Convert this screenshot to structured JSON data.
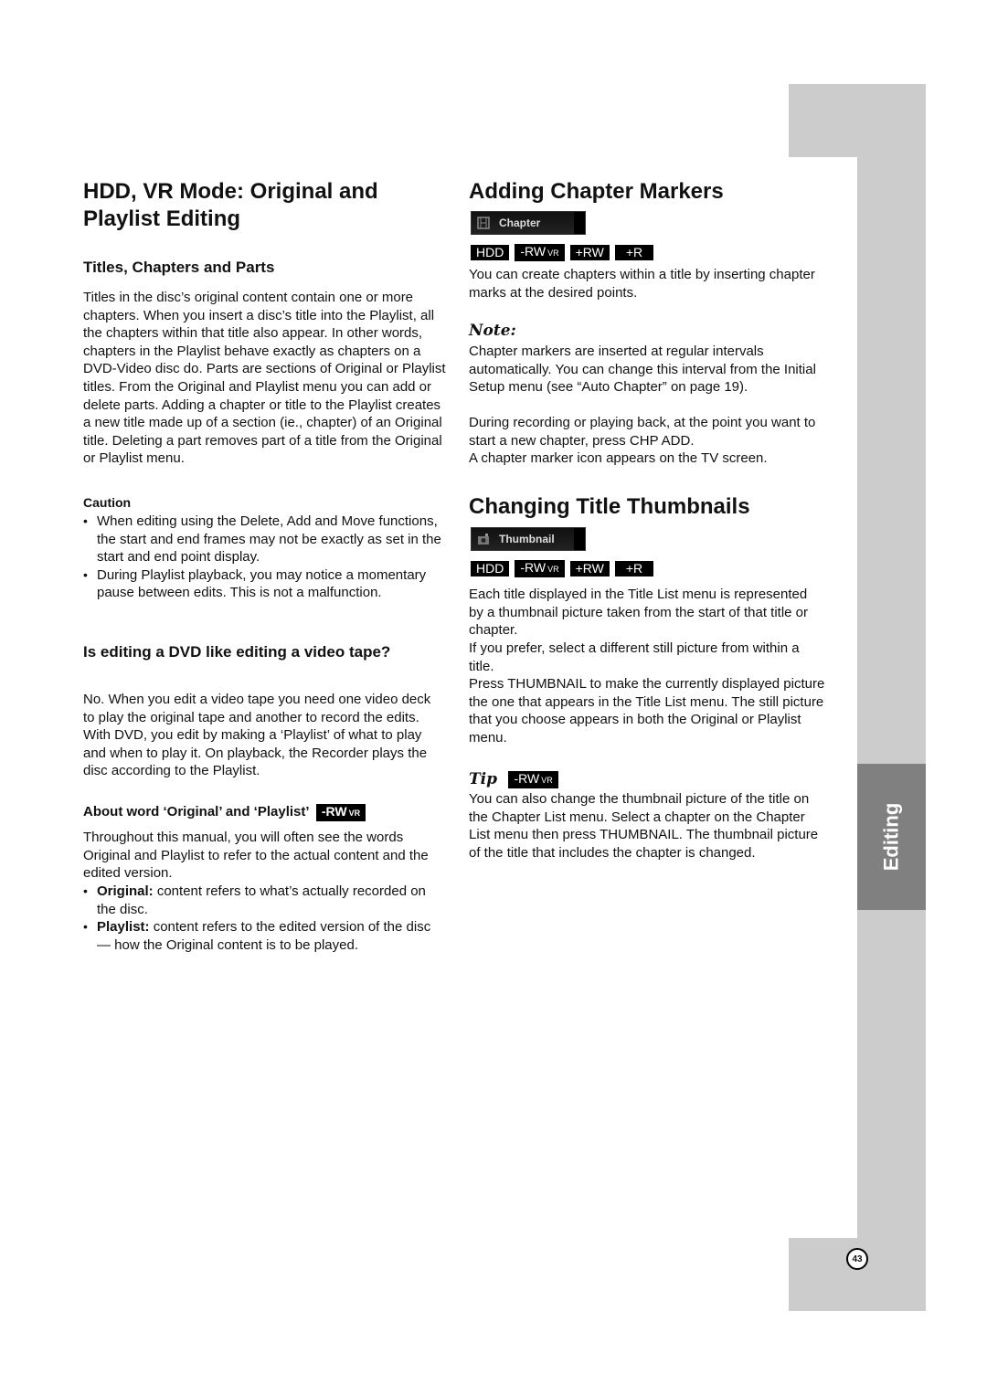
{
  "left": {
    "title_line1": "HDD, VR Mode: Original and",
    "title_line2": "Playlist Editing",
    "sub1": "Titles, Chapters and Parts",
    "para1": "Titles in the disc’s original content contain one or more chapters. When you insert a disc’s title into the Playlist, all the chapters within that title also appear. In other words, chapters in the Playlist behave exactly as chapters on a DVD-Video disc do. Parts are sections of Original or Playlist titles. From the Original and Playlist menu you can add or delete parts. Adding a chapter or title to the Playlist creates a new title made up of a section (ie., chapter) of an Original title. Deleting a part removes part of a title from the Original or Playlist menu.",
    "caution_label": "Caution",
    "caution_items": [
      "When editing using the Delete, Add and Move functions, the start and end frames may not be exactly as set in the start and end point display.",
      "During Playlist playback, you may notice a momentary pause between edits. This is not a malfunction."
    ],
    "sub2": "Is editing a DVD like editing a video tape?",
    "para2": "No. When you edit a video tape you need one video deck to play the original tape and another to record the edits. With DVD, you edit by making a ‘Playlist’ of what to play and when to play it. On playback, the Recorder plays the disc according to the Playlist.",
    "sub3": "About word ‘Original’ and ‘Playlist’",
    "sub3_badge": "-RW",
    "sub3_badge_small": "VR",
    "para3": "Throughout this manual, you will often see the words Original and Playlist to refer to the actual content and the edited version.",
    "defs": [
      {
        "term": "Original:",
        "text": " content refers to what’s actually recorded on the disc."
      },
      {
        "term": "Playlist:",
        "text": " content refers to the edited version of the disc — how the Original content is to be played."
      }
    ]
  },
  "right": {
    "title1": "Adding Chapter Markers",
    "osd1": {
      "label": "Chapter",
      "icon": "film-icon"
    },
    "badges": [
      {
        "main": "HDD",
        "small": ""
      },
      {
        "main": "-RW",
        "small": "VR"
      },
      {
        "main": "+RW",
        "small": ""
      },
      {
        "main": "+R",
        "small": ""
      }
    ],
    "para1": "You can create chapters within a title by inserting chapter marks at the desired points.",
    "note_label": "Note:",
    "note1": "Chapter markers are inserted at regular intervals automatically. You can change this interval from the Initial Setup menu (see “Auto Chapter” on page 19).",
    "note2": "During recording or playing back, at the point you want to start a new chapter, press CHP ADD.",
    "note3": "A chapter marker icon appears on the TV screen.",
    "title2": "Changing Title Thumbnails",
    "osd2": {
      "label": "Thumbnail",
      "icon": "camera-icon"
    },
    "para2a": "Each title displayed in the Title List menu is represented by a thumbnail picture taken from the start of that title or chapter.",
    "para2b": "If you prefer, select a different still picture from within a title.",
    "para2c": "Press THUMBNAIL to make the currently displayed picture the one that appears in the Title List menu. The still picture that you choose appears in both the Original or Playlist menu.",
    "tip_label": "Tip",
    "tip_badge": "-RW",
    "tip_badge_small": "VR",
    "tip_text": "You can also change the thumbnail picture of the title on the Chapter List menu. Select a chapter on the Chapter List menu then press THUMBNAIL. The thumbnail picture of the title that includes the chapter is changed."
  },
  "side": {
    "tab_label": "Editing",
    "page_number": "43"
  }
}
